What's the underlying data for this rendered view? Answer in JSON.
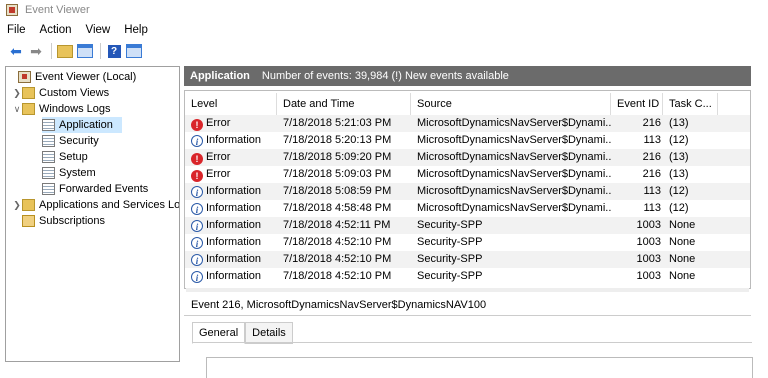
{
  "window": {
    "title": "Event Viewer"
  },
  "menu": [
    "File",
    "Action",
    "View",
    "Help"
  ],
  "toolbar": {
    "icons": [
      "back-icon",
      "forward-icon",
      "up-folder-icon",
      "show-hide-tree-icon",
      "help-icon",
      "action-pane-icon"
    ]
  },
  "tree": {
    "items": [
      {
        "label": "Event Viewer (Local)",
        "icon": "event-viewer-icon"
      },
      {
        "label": "Custom Views",
        "icon": "folder-icon"
      },
      {
        "label": "Windows Logs",
        "icon": "folder-icon"
      },
      {
        "label": "Application",
        "icon": "log-icon"
      },
      {
        "label": "Security",
        "icon": "log-icon"
      },
      {
        "label": "Setup",
        "icon": "log-icon"
      },
      {
        "label": "System",
        "icon": "log-icon"
      },
      {
        "label": "Forwarded Events",
        "icon": "log-icon"
      },
      {
        "label": "Applications and Services Lo",
        "icon": "folder-icon"
      },
      {
        "label": "Subscriptions",
        "icon": "subscriptions-icon"
      }
    ]
  },
  "header": {
    "title": "Application",
    "info": "Number of events: 39,984 (!) New events available"
  },
  "grid": {
    "columns": [
      "Level",
      "Date and Time",
      "Source",
      "Event ID",
      "Task C..."
    ],
    "rows": [
      {
        "level": "Error",
        "datetime": "7/18/2018 5:21:03 PM",
        "source": "MicrosoftDynamicsNavServer$Dynami...",
        "eventid": "216",
        "task": "(13)"
      },
      {
        "level": "Information",
        "datetime": "7/18/2018 5:20:13 PM",
        "source": "MicrosoftDynamicsNavServer$Dynami...",
        "eventid": "113",
        "task": "(12)"
      },
      {
        "level": "Error",
        "datetime": "7/18/2018 5:09:20 PM",
        "source": "MicrosoftDynamicsNavServer$Dynami...",
        "eventid": "216",
        "task": "(13)"
      },
      {
        "level": "Error",
        "datetime": "7/18/2018 5:09:03 PM",
        "source": "MicrosoftDynamicsNavServer$Dynami...",
        "eventid": "216",
        "task": "(13)"
      },
      {
        "level": "Information",
        "datetime": "7/18/2018 5:08:59 PM",
        "source": "MicrosoftDynamicsNavServer$Dynami...",
        "eventid": "113",
        "task": "(12)"
      },
      {
        "level": "Information",
        "datetime": "7/18/2018 4:58:48 PM",
        "source": "MicrosoftDynamicsNavServer$Dynami...",
        "eventid": "113",
        "task": "(12)"
      },
      {
        "level": "Information",
        "datetime": "7/18/2018 4:52:11 PM",
        "source": "Security-SPP",
        "eventid": "1003",
        "task": "None"
      },
      {
        "level": "Information",
        "datetime": "7/18/2018 4:52:10 PM",
        "source": "Security-SPP",
        "eventid": "1003",
        "task": "None"
      },
      {
        "level": "Information",
        "datetime": "7/18/2018 4:52:10 PM",
        "source": "Security-SPP",
        "eventid": "1003",
        "task": "None"
      },
      {
        "level": "Information",
        "datetime": "7/18/2018 4:52:10 PM",
        "source": "Security-SPP",
        "eventid": "1003",
        "task": "None"
      }
    ]
  },
  "detail": {
    "title": "Event 216, MicrosoftDynamicsNavServer$DynamicsNAV100",
    "tabs": [
      "General",
      "Details"
    ]
  },
  "colors": {
    "error": "#d9252a",
    "info": "#2b5aa8",
    "header_bar": "#6b6b6b",
    "selection": "#cce8ff"
  }
}
